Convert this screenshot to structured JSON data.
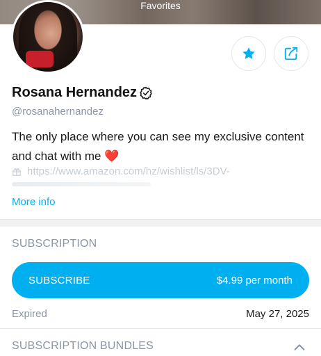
{
  "cover": {
    "title": "Favorites"
  },
  "profile": {
    "name": "Rosana Hernandez",
    "handle": "@rosanahernandez",
    "bio": "The only place where you can see my exclusive content and chat with me",
    "bio_emoji": "❤️",
    "link": "https://www.amazon.com/hz/wishlist/ls/3DV-",
    "more_info": "More info"
  },
  "actions": {
    "favorite_icon": "star-icon",
    "share_icon": "share-icon"
  },
  "subscription": {
    "title": "SUBSCRIPTION",
    "button_label": "SUBSCRIBE",
    "price": "$4.99 per month",
    "expired_label": "Expired",
    "expired_date": "May 27, 2025"
  },
  "bundles": {
    "title": "SUBSCRIPTION BUNDLES"
  },
  "colors": {
    "accent": "#00aff0",
    "muted": "#8a96a3",
    "heart": "#f04e5e"
  }
}
